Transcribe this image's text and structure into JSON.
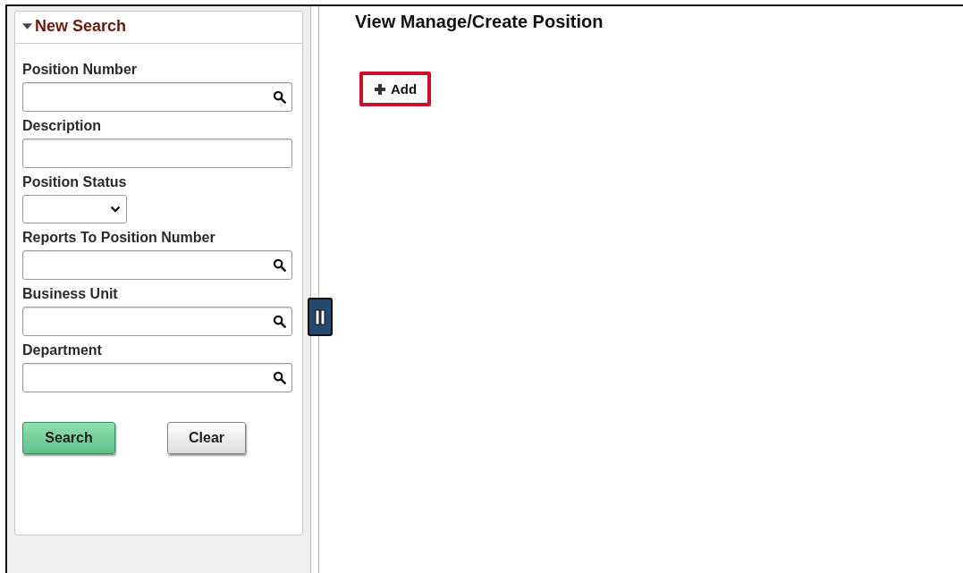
{
  "search_panel": {
    "title": "New Search",
    "expanded": true,
    "fields": [
      {
        "label": "Position Number",
        "kind": "lookup"
      },
      {
        "label": "Description",
        "kind": "text"
      },
      {
        "label": "Position Status",
        "kind": "select"
      },
      {
        "label": "Reports To Position Number",
        "kind": "lookup"
      },
      {
        "label": "Business Unit",
        "kind": "lookup"
      },
      {
        "label": "Department",
        "kind": "lookup"
      }
    ],
    "buttons": [
      {
        "label": "Search",
        "kind": "primary"
      },
      {
        "label": "Clear",
        "kind": "secondary"
      }
    ]
  },
  "page": {
    "title": "View Manage/Create Position",
    "add_button": {
      "label": "Add",
      "highlighted": true
    }
  }
}
